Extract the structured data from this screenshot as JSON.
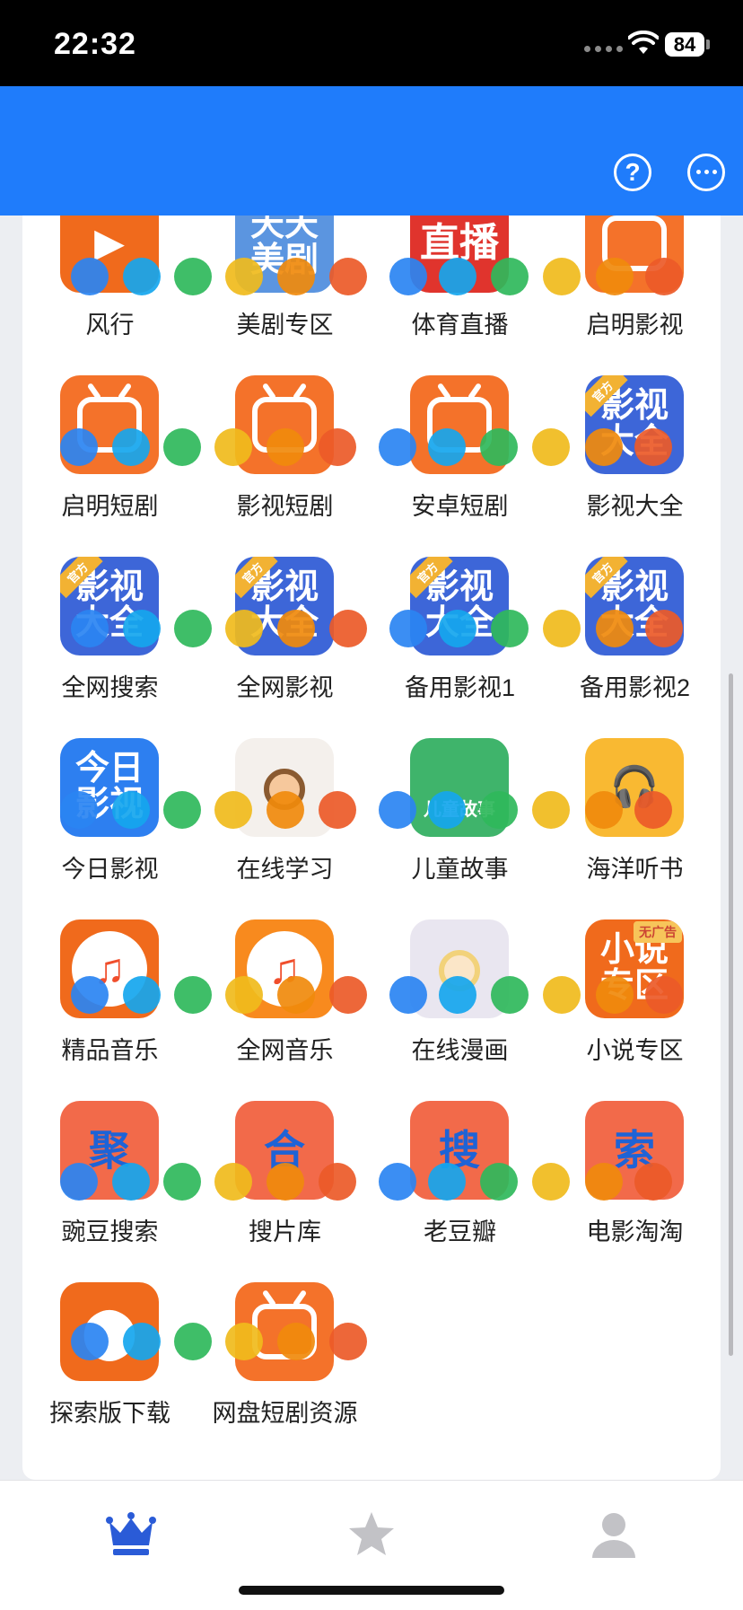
{
  "status_bar": {
    "time": "22:32",
    "battery": "84"
  },
  "header": {
    "help_label": "?",
    "chat_label": "chat"
  },
  "apps": [
    {
      "label": "风行",
      "art": "",
      "bg": "#f06a1c"
    },
    {
      "label": "美剧专区",
      "art": "天天 美剧",
      "bg": "#5b95e0"
    },
    {
      "label": "体育直播",
      "art": "直播",
      "bg": "#e0342d"
    },
    {
      "label": "启明影视",
      "art": "",
      "bg": "#f4722a"
    },
    {
      "label": "启明短剧",
      "art": "",
      "bg": "#f4722a"
    },
    {
      "label": "影视短剧",
      "art": "",
      "bg": "#f4722a"
    },
    {
      "label": "安卓短剧",
      "art": "",
      "bg": "#f4722a"
    },
    {
      "label": "影视大全",
      "art": "影视 大全",
      "bg": "#3d66d8"
    },
    {
      "label": "全网搜索",
      "art": "影视 大全",
      "bg": "#3d66d8"
    },
    {
      "label": "全网影视",
      "art": "影视 大全",
      "bg": "#3d66d8"
    },
    {
      "label": "备用影视1",
      "art": "影视 大全",
      "bg": "#3d66d8"
    },
    {
      "label": "备用影视2",
      "art": "影视 大全",
      "bg": "#3d66d8"
    },
    {
      "label": "今日影视",
      "art": "今日 影视",
      "bg": "#2d7ff0"
    },
    {
      "label": "在线学习",
      "art": "",
      "bg": "#f4f0ec"
    },
    {
      "label": "儿童故事",
      "art": "儿童故事",
      "bg": "#3fb46b"
    },
    {
      "label": "海洋听书",
      "art": "",
      "bg": "#f9b932"
    },
    {
      "label": "精品音乐",
      "art": "",
      "bg": "#f06a1c"
    },
    {
      "label": "全网音乐",
      "art": "",
      "bg": "#f88a1e"
    },
    {
      "label": "在线漫画",
      "art": "",
      "bg": "#e9e6f0"
    },
    {
      "label": "小说专区",
      "art": "小说 专区",
      "bg": "#f06a1c"
    },
    {
      "label": "豌豆搜索",
      "art": "聚",
      "bg": "#f26a4a"
    },
    {
      "label": "搜片库",
      "art": "合",
      "bg": "#f26a4a"
    },
    {
      "label": "老豆瓣",
      "art": "搜",
      "bg": "#f26a4a"
    },
    {
      "label": "电影淘淘",
      "art": "索",
      "bg": "#f26a4a"
    },
    {
      "label": "探索版下载",
      "art": "",
      "bg": "#f06a1c"
    },
    {
      "label": "网盘短剧资源",
      "art": "",
      "bg": "#f4722a"
    }
  ],
  "badges": {
    "official": "官方",
    "free": "无广告"
  },
  "tabs": {
    "home": "home",
    "favorites": "favorites",
    "profile": "profile"
  },
  "colors": {
    "header_blue": "#1f7cfb",
    "tab_active": "#2a5bd7",
    "tab_inactive": "#c2c2c6"
  }
}
